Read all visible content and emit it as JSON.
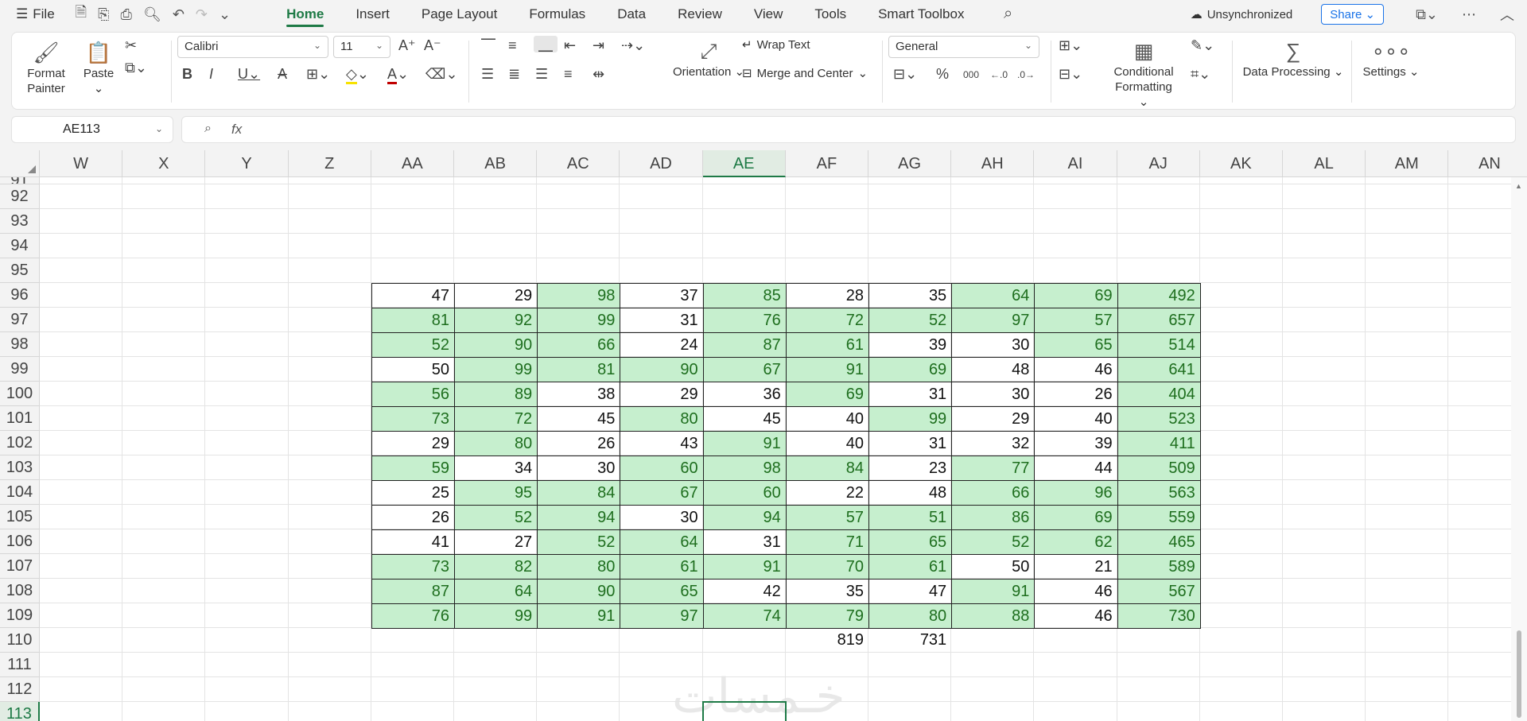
{
  "menubar": {
    "file_label": "File",
    "tabs": [
      "Home",
      "Insert",
      "Page Layout",
      "Formulas",
      "Data",
      "Review",
      "View",
      "Tools",
      "Smart Toolbox"
    ],
    "active_tab": "Home",
    "sync_status": "Unsynchronized",
    "share_label": "Share"
  },
  "ribbon": {
    "format_painter": "Format Painter",
    "paste": "Paste",
    "font_name": "Calibri",
    "font_size": "11",
    "orientation": "Orientation",
    "wrap_text": "Wrap Text",
    "merge_center": "Merge and Center",
    "number_format": "General",
    "conditional_formatting": "Conditional Formatting",
    "data_processing": "Data Processing",
    "settings": "Settings"
  },
  "formula_bar": {
    "cell_ref": "AE113",
    "fx_label": "fx",
    "content": ""
  },
  "sheet": {
    "columns": [
      "W",
      "X",
      "Y",
      "Z",
      "AA",
      "AB",
      "AC",
      "AD",
      "AE",
      "AF",
      "AG",
      "AH",
      "AI",
      "AJ",
      "AK",
      "AL",
      "AM",
      "AN"
    ],
    "active_column": "AE",
    "rows": [
      "91",
      "92",
      "93",
      "94",
      "95",
      "96",
      "97",
      "98",
      "99",
      "100",
      "101",
      "102",
      "103",
      "104",
      "105",
      "106",
      "107",
      "108",
      "109",
      "110",
      "111",
      "112",
      "113"
    ],
    "active_row": "113",
    "table": [
      [
        "47",
        "29",
        "98",
        "37",
        "85",
        "28",
        "35",
        "64",
        "69",
        "492"
      ],
      [
        "81",
        "92",
        "99",
        "31",
        "76",
        "72",
        "52",
        "97",
        "57",
        "657"
      ],
      [
        "52",
        "90",
        "66",
        "24",
        "87",
        "61",
        "39",
        "30",
        "65",
        "514"
      ],
      [
        "50",
        "99",
        "81",
        "90",
        "67",
        "91",
        "69",
        "48",
        "46",
        "641"
      ],
      [
        "56",
        "89",
        "38",
        "29",
        "36",
        "69",
        "31",
        "30",
        "26",
        "404"
      ],
      [
        "73",
        "72",
        "45",
        "80",
        "45",
        "40",
        "99",
        "29",
        "40",
        "523"
      ],
      [
        "29",
        "80",
        "26",
        "43",
        "91",
        "40",
        "31",
        "32",
        "39",
        "411"
      ],
      [
        "59",
        "34",
        "30",
        "60",
        "98",
        "84",
        "23",
        "77",
        "44",
        "509"
      ],
      [
        "25",
        "95",
        "84",
        "67",
        "60",
        "22",
        "48",
        "66",
        "96",
        "563"
      ],
      [
        "26",
        "52",
        "94",
        "30",
        "94",
        "57",
        "51",
        "86",
        "69",
        "559"
      ],
      [
        "41",
        "27",
        "52",
        "64",
        "31",
        "71",
        "65",
        "52",
        "62",
        "465"
      ],
      [
        "73",
        "82",
        "80",
        "61",
        "91",
        "70",
        "61",
        "50",
        "21",
        "589"
      ],
      [
        "87",
        "64",
        "90",
        "65",
        "42",
        "35",
        "47",
        "91",
        "46",
        "567"
      ],
      [
        "76",
        "99",
        "91",
        "97",
        "74",
        "79",
        "80",
        "88",
        "46",
        "730"
      ]
    ],
    "highlight": [
      [
        0,
        0,
        1,
        0,
        1,
        0,
        0,
        1,
        1,
        1
      ],
      [
        1,
        1,
        1,
        0,
        1,
        1,
        1,
        1,
        1,
        1
      ],
      [
        1,
        1,
        1,
        0,
        1,
        1,
        0,
        0,
        1,
        1
      ],
      [
        0,
        1,
        1,
        1,
        1,
        1,
        1,
        0,
        0,
        1
      ],
      [
        1,
        1,
        0,
        0,
        0,
        1,
        0,
        0,
        0,
        1
      ],
      [
        1,
        1,
        0,
        1,
        0,
        0,
        1,
        0,
        0,
        1
      ],
      [
        0,
        1,
        0,
        0,
        1,
        0,
        0,
        0,
        0,
        1
      ],
      [
        1,
        0,
        0,
        1,
        1,
        1,
        0,
        1,
        0,
        1
      ],
      [
        0,
        1,
        1,
        1,
        1,
        0,
        0,
        1,
        1,
        1
      ],
      [
        0,
        1,
        1,
        0,
        1,
        1,
        1,
        1,
        1,
        1
      ],
      [
        0,
        0,
        1,
        1,
        0,
        1,
        1,
        1,
        1,
        1
      ],
      [
        1,
        1,
        1,
        1,
        1,
        1,
        1,
        0,
        0,
        1
      ],
      [
        1,
        1,
        1,
        1,
        0,
        0,
        0,
        1,
        0,
        1
      ],
      [
        1,
        1,
        1,
        1,
        1,
        1,
        1,
        1,
        0,
        1
      ]
    ],
    "row110": {
      "AF": "819",
      "AG": "731"
    }
  },
  "colors": {
    "accent": "#1e7a46",
    "highlight_fill": "#c6efce",
    "highlight_text": "#1e6e1e"
  }
}
